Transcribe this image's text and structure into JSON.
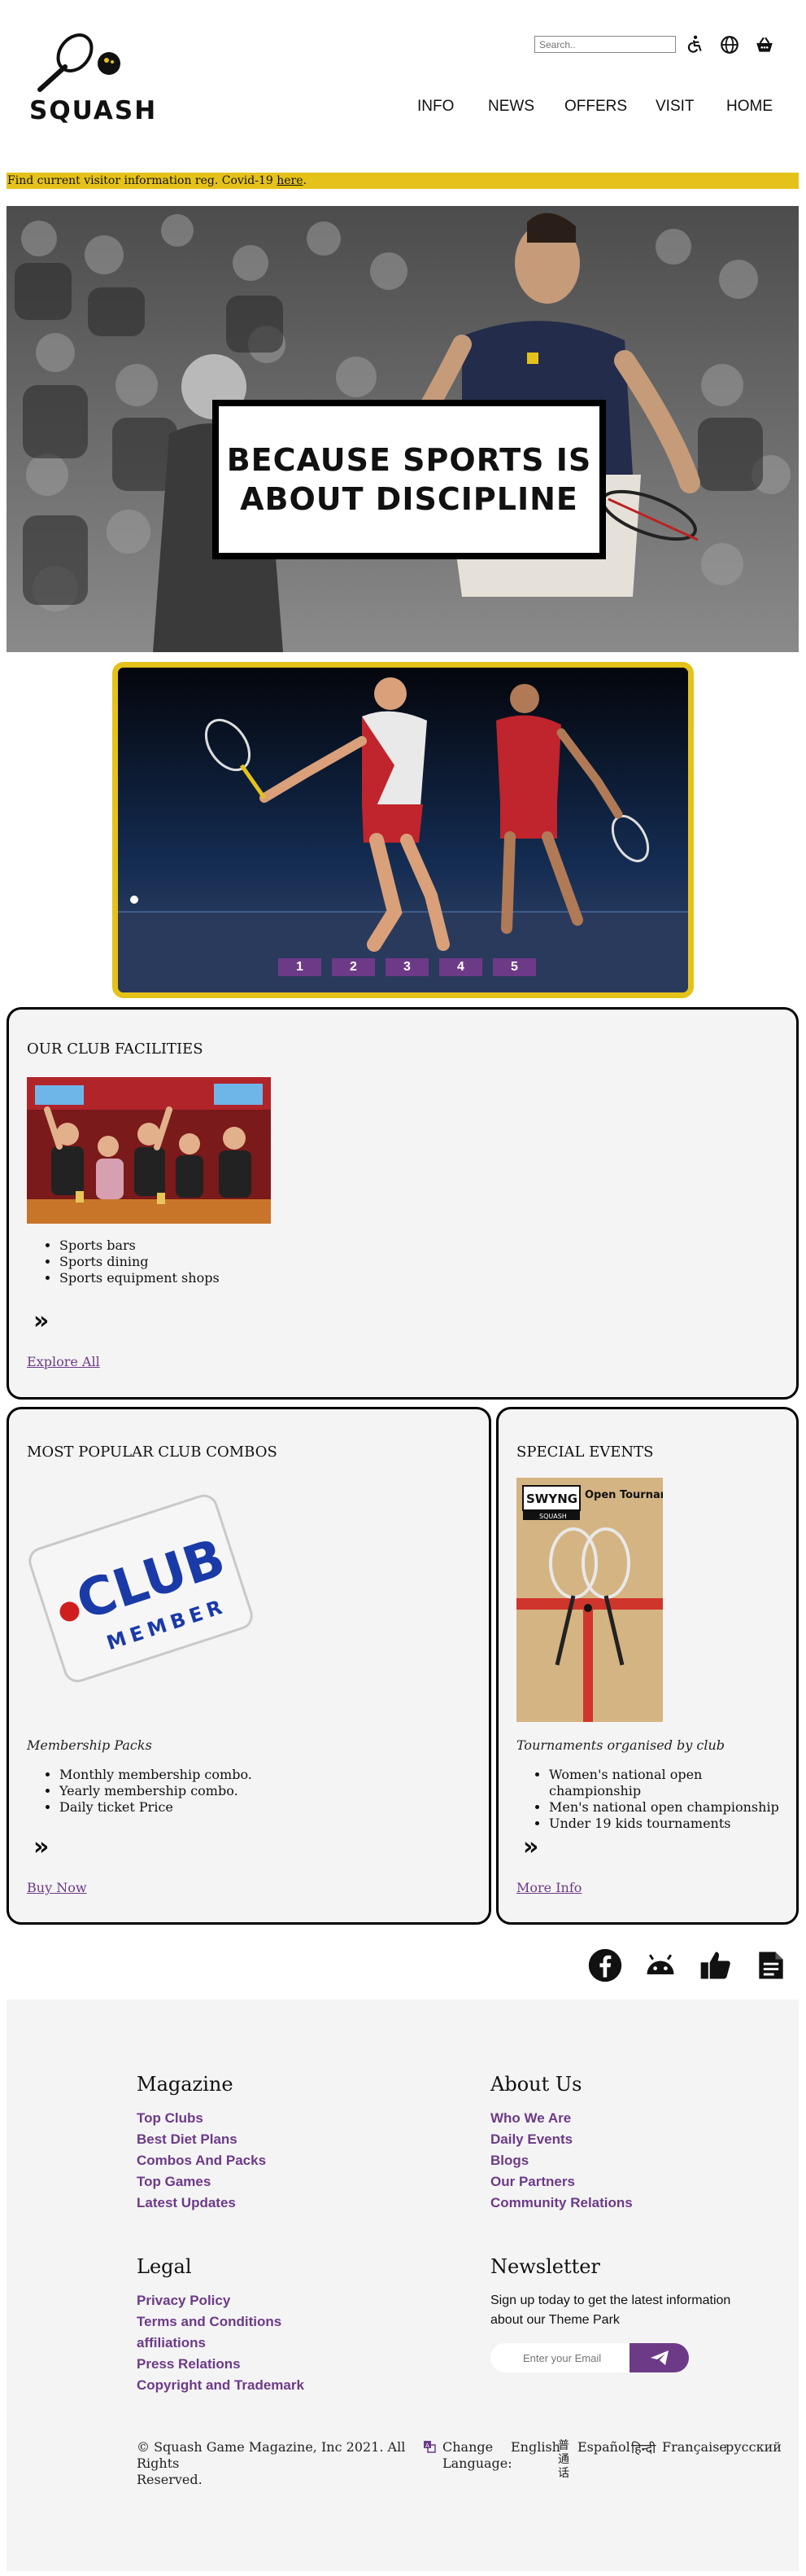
{
  "header": {
    "logo_text": "SQUASH",
    "search_placeholder": "Search..",
    "nav": [
      "INFO",
      "NEWS",
      "OFFERS",
      "VISIT",
      "HOME"
    ]
  },
  "notice": {
    "text": "Find current visitor information reg. Covid-19 ",
    "link": "here",
    "tail": "."
  },
  "hero": {
    "title_line1": "BECAUSE SPORTS IS",
    "title_line2": "ABOUT DISCIPLINE"
  },
  "carousel": {
    "slides": [
      "1",
      "2",
      "3",
      "4",
      "5"
    ]
  },
  "facilities": {
    "title": "OUR CLUB FACILITIES",
    "items": [
      "Sports bars",
      "Sports dining",
      "Sports equipment shops"
    ],
    "chevron": "»",
    "link": "Explore All"
  },
  "combos": {
    "title": "MOST POPULAR CLUB COMBOS",
    "card_word1": "CLUB",
    "card_word2": "MEMBER",
    "subtitle": "Membership Packs",
    "items": [
      "Monthly membership combo.",
      "Yearly membership combo.",
      "Daily ticket Price"
    ],
    "chevron": "»",
    "link": "Buy Now"
  },
  "events": {
    "title": "SPECIAL EVENTS",
    "poster_brand": "SWYNG",
    "poster_brand_sub": "SQUASH",
    "poster_title": "Open Tournament",
    "subtitle": "Tournaments organised by club",
    "items": [
      "Women's national open championship",
      "Men's national open championship",
      "Under 19 kids tournaments"
    ],
    "chevron": "»",
    "link": "More Info"
  },
  "footer": {
    "magazine": {
      "title": "Magazine",
      "links": [
        "Top Clubs",
        "Best Diet Plans",
        "Combos And Packs",
        "Top Games",
        "Latest Updates"
      ]
    },
    "about": {
      "title": "About Us",
      "links": [
        "Who We Are",
        "Daily Events",
        "Blogs",
        "Our Partners",
        "Community Relations"
      ]
    },
    "legal": {
      "title": "Legal",
      "links": [
        "Privacy Policy",
        "Terms and Conditions",
        "affiliations",
        "Press Relations",
        "Copyright and Trademark"
      ]
    },
    "newsletter": {
      "title": "Newsletter",
      "line1": "Sign up today to get the latest information",
      "line2": "about our Theme Park",
      "placeholder": "Enter your Email"
    },
    "copyright_line1": "© Squash Game Magazine, Inc 2021. All Rights",
    "copyright_line2": "Reserved.",
    "change_language_1": "Change",
    "change_language_2": "Language:",
    "languages": [
      "English",
      "普通话",
      "Español",
      "हिन्दी",
      "Française",
      "русский"
    ]
  },
  "colors": {
    "accent_purple": "#6d3a88",
    "notice_yellow": "#e5c21a",
    "footer_bg": "#f4f4f4"
  }
}
